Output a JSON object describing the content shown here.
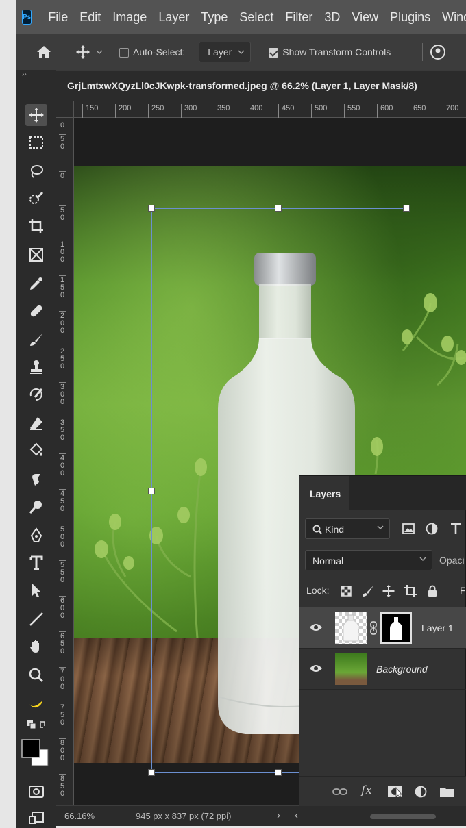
{
  "app": {
    "logo": "Ps"
  },
  "menu": [
    "File",
    "Edit",
    "Image",
    "Layer",
    "Type",
    "Select",
    "Filter",
    "3D",
    "View",
    "Plugins",
    "Windo"
  ],
  "options": {
    "auto_select_label": "Auto-Select:",
    "auto_select_checked": false,
    "layer_select_value": "Layer",
    "show_transform_label": "Show Transform Controls",
    "show_transform_checked": true
  },
  "panel_collapse": "››",
  "document": {
    "tab_title": "GrjLmtxwXQyzLl0cJKwpk-transformed.jpeg @ 66.2% (Layer 1, Layer Mask/8)"
  },
  "ruler": {
    "top": [
      "150",
      "200",
      "250",
      "300",
      "350",
      "400",
      "450",
      "500",
      "550",
      "600",
      "650",
      "700"
    ],
    "left": [
      "0",
      "5 0",
      "0",
      "5 0",
      "1 0 0",
      "1 5 0",
      "2 0 0",
      "2 5 0",
      "3 0 0",
      "3 5 0",
      "4 0 0",
      "4 5 0",
      "5 0 0",
      "5 5 0",
      "6 0 0",
      "6 5 0",
      "7 0 0",
      "7 5 0",
      "8 0 0",
      "8 5 0"
    ]
  },
  "tools": [
    "move-icon",
    "marquee-icon",
    "lasso-icon",
    "quick-select-icon",
    "crop-icon",
    "frame-icon",
    "eyedropper-icon",
    "healing-brush-icon",
    "brush-icon",
    "clone-stamp-icon",
    "history-brush-icon",
    "eraser-icon",
    "paint-bucket-icon",
    "smudge-icon",
    "dodge-icon",
    "pen-icon",
    "type-icon",
    "path-select-icon",
    "line-icon",
    "hand-icon",
    "zoom-icon",
    "banana-icon",
    "default-colors-icon",
    "foreground-color-swatch",
    "quick-mask-icon",
    "screen-mode-icon"
  ],
  "colors": {
    "foreground": "#000000",
    "background": "#ffffff",
    "selection": "#6b8fd0"
  },
  "status": {
    "zoom": "66.16%",
    "doc_info": "945 px x 837 px (72 ppi)",
    "arrow": "›",
    "arrow_left": "‹"
  },
  "layers_panel": {
    "tab_label": "Layers",
    "kind_label": "Kind",
    "blend_mode": "Normal",
    "opacity_label": "Opaci",
    "lock_label": "Lock:",
    "fill_label": "F",
    "layers": [
      {
        "name": "Layer 1",
        "visible": true,
        "selected": true,
        "has_mask": true
      },
      {
        "name": "Background",
        "visible": true,
        "selected": false,
        "has_mask": false
      }
    ],
    "footer_fx": "fx"
  }
}
